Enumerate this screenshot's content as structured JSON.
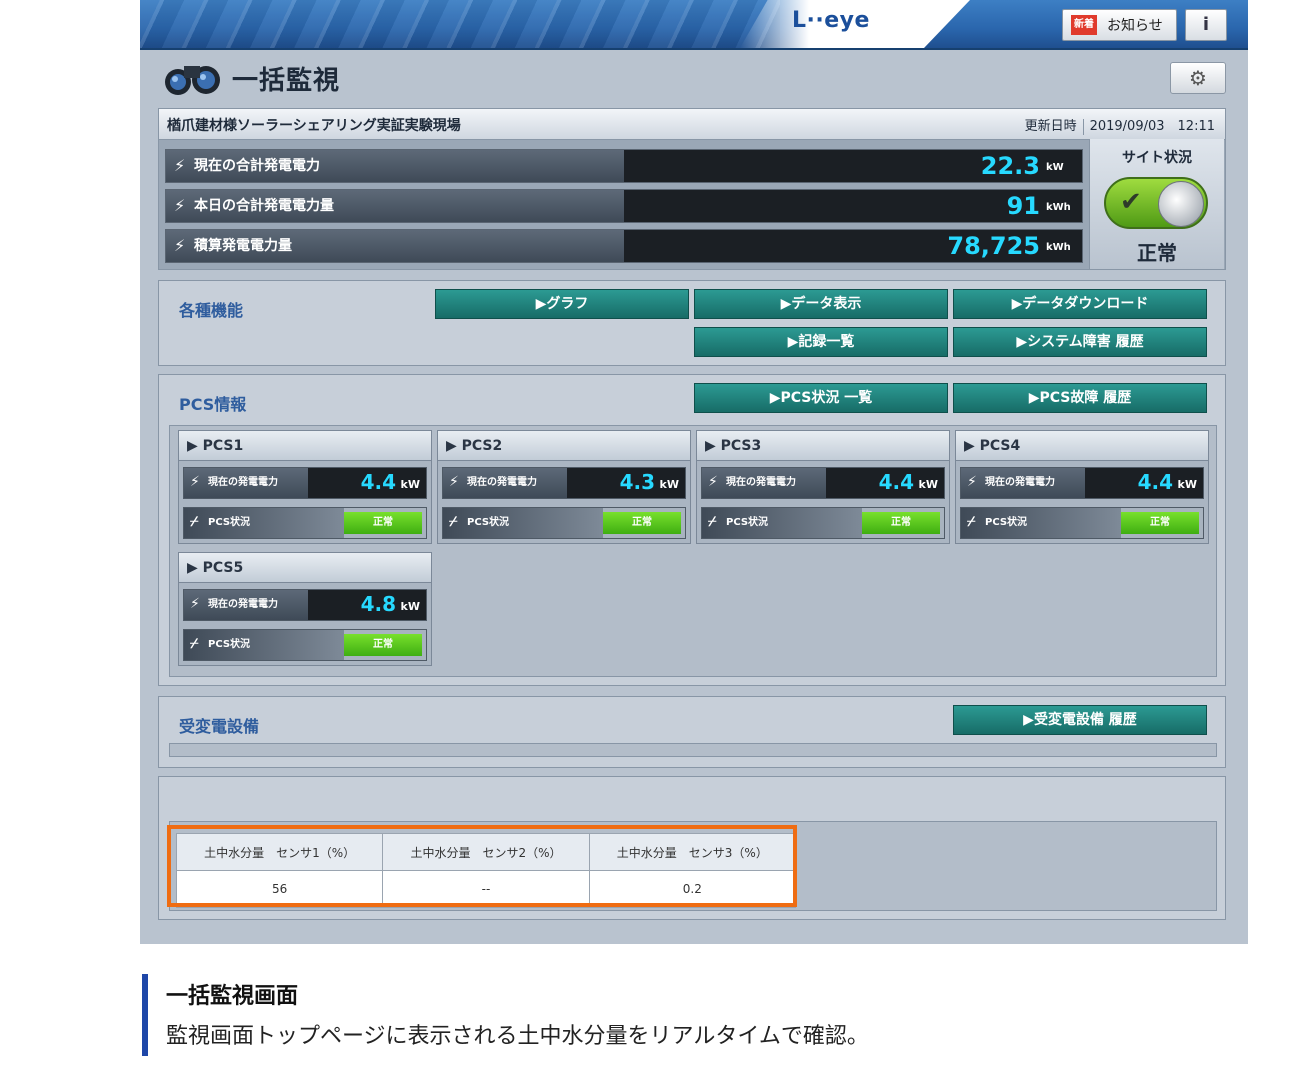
{
  "app": {
    "logo": "L··eye",
    "news_badge": "新着",
    "news_label": "お知らせ",
    "info_label": "i",
    "page_title": "一括監視",
    "settings_icon": "⚙"
  },
  "site": {
    "name": "楢爪建材様ソーラーシェアリング実証実験現場",
    "updated_label": "更新日時",
    "updated_value": "2019/09/03　12:11",
    "metrics": [
      {
        "label": "現在の合計発電電力",
        "value": "22.3",
        "unit": "kW"
      },
      {
        "label": "本日の合計発電電力量",
        "value": "91",
        "unit": "kWh"
      },
      {
        "label": "積算発電電力量",
        "value": "78,725",
        "unit": "kWh"
      }
    ],
    "status_title": "サイト状況",
    "status_text": "正常"
  },
  "functions": {
    "title": "各種機能",
    "buttons": [
      "▶グラフ",
      "▶データ表示",
      "▶データダウンロード",
      "▶記録一覧",
      "▶システム障害 履歴"
    ]
  },
  "pcs": {
    "title": "PCS情報",
    "buttons": [
      "▶PCS状況 一覧",
      "▶PCS故障 履歴"
    ],
    "power_label": "現在の発電電力",
    "status_label": "PCS状況",
    "units": [
      {
        "name": "▶ PCS1",
        "value": "4.4",
        "unit": "kW",
        "status": "正常"
      },
      {
        "name": "▶ PCS2",
        "value": "4.3",
        "unit": "kW",
        "status": "正常"
      },
      {
        "name": "▶ PCS3",
        "value": "4.4",
        "unit": "kW",
        "status": "正常"
      },
      {
        "name": "▶ PCS4",
        "value": "4.4",
        "unit": "kW",
        "status": "正常"
      },
      {
        "name": "▶ PCS5",
        "value": "4.8",
        "unit": "kW",
        "status": "正常"
      }
    ]
  },
  "substation": {
    "title": "受変電設備",
    "button": "▶受変電設備 履歴"
  },
  "sensors": {
    "headers": [
      "土中水分量　センサ1（%）",
      "土中水分量　センサ2（%）",
      "土中水分量　センサ3（%）"
    ],
    "values": [
      "56",
      "--",
      "0.2"
    ]
  },
  "caption": {
    "title": "一括監視画面",
    "body": "監視画面トップページに表示される土中水分量をリアルタイムで確認。"
  },
  "colors": {
    "accent": "#2f5d9e",
    "value": "#27d9ff",
    "ok": "#4cbf16",
    "highlight": "#ef6c12"
  }
}
